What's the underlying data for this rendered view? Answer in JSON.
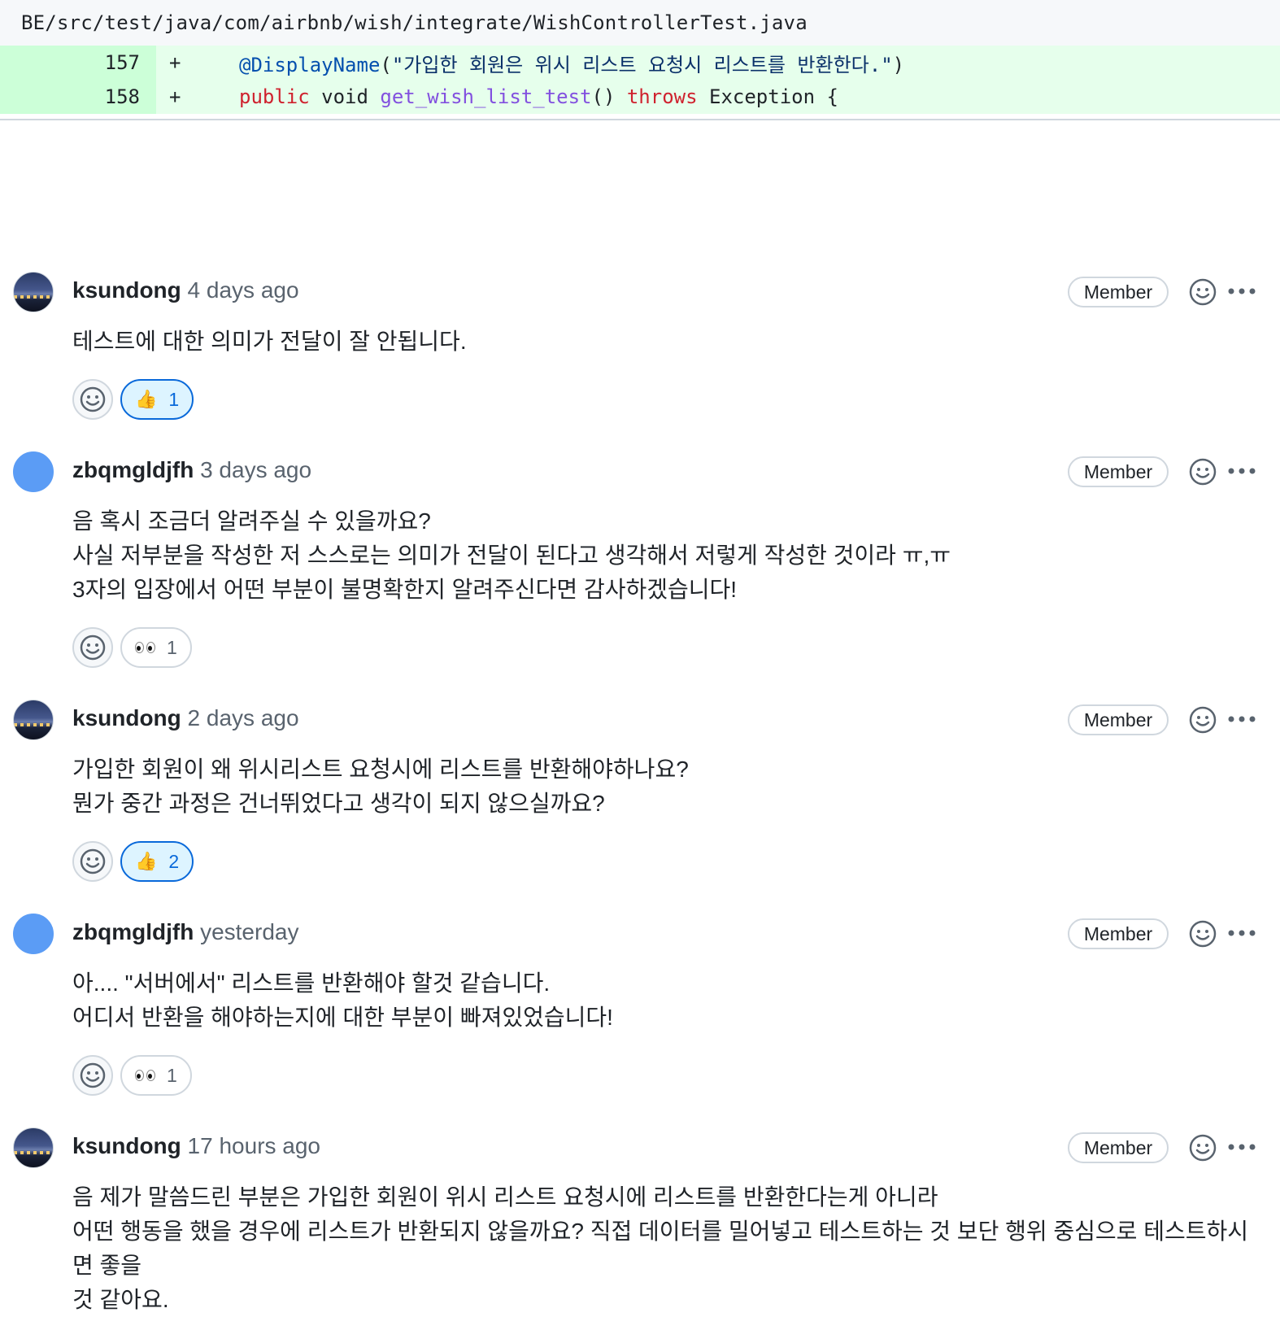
{
  "file": {
    "path": "BE/src/test/java/com/airbnb/wish/integrate/WishControllerTest.java"
  },
  "diff": {
    "lines": [
      {
        "num": "157",
        "sign": "+",
        "tokens": {
          "t1": "@DisplayName",
          "t2": "(",
          "t3": "\"가입한 회원은 위시 리스트 요청시 리스트를 반환한다.\"",
          "t4": ")"
        }
      },
      {
        "num": "158",
        "sign": "+",
        "tokens": {
          "t1": "public",
          "t2": " void ",
          "t3": "get_wish_list_test",
          "t4": "() ",
          "t5": "throws",
          "t6": " Exception {"
        }
      }
    ]
  },
  "comments": [
    {
      "author": "ksundong",
      "time": "4 days ago",
      "badge": "Member",
      "body": "테스트에 대한 의미가 전달이 잘 안됩니다.",
      "reaction": {
        "icon": "thumbs-up-icon",
        "count": "1",
        "active": true
      }
    },
    {
      "author": "zbqmgldjfh",
      "time": "3 days ago",
      "badge": "Member",
      "body": "음 혹시 조금더 알려주실 수 있을까요?\n사실 저부분을 작성한 저 스스로는 의미가 전달이 된다고 생각해서 저렇게 작성한 것이라 ㅠ,ㅠ\n3자의 입장에서 어떤 부분이 불명확한지 알려주신다면 감사하겠습니다!",
      "reaction": {
        "icon": "eyes-icon",
        "count": "1",
        "active": false
      }
    },
    {
      "author": "ksundong",
      "time": "2 days ago",
      "badge": "Member",
      "body": "가입한 회원이 왜 위시리스트 요청시에 리스트를 반환해야하나요?\n뭔가 중간 과정은 건너뛰었다고 생각이 되지 않으실까요?",
      "reaction": {
        "icon": "thumbs-up-icon",
        "count": "2",
        "active": true
      }
    },
    {
      "author": "zbqmgldjfh",
      "time": "yesterday",
      "badge": "Member",
      "body": "아.... \"서버에서\" 리스트를 반환해야 할것 같습니다.\n어디서 반환을 해야하는지에 대한 부분이 빠져있었습니다!",
      "reaction": {
        "icon": "eyes-icon",
        "count": "1",
        "active": false
      }
    },
    {
      "author": "ksundong",
      "time": "17 hours ago",
      "badge": "Member",
      "body": "음 제가 말씀드린 부분은 가입한 회원이 위시 리스트 요청시에 리스트를 반환한다는게 아니라\n어떤 행동을 했을 경우에 리스트가 반환되지 않을까요? 직접 데이터를 밀어넣고 테스트하는 것 보단 행위 중심으로 테스트하시면 좋을\n것 같아요."
    }
  ],
  "colors": {
    "accent": "#0969da",
    "diff_add_bg": "#e6ffec",
    "diff_num_bg": "#ccffd8",
    "avatar_blue": "#5b9cf5"
  }
}
